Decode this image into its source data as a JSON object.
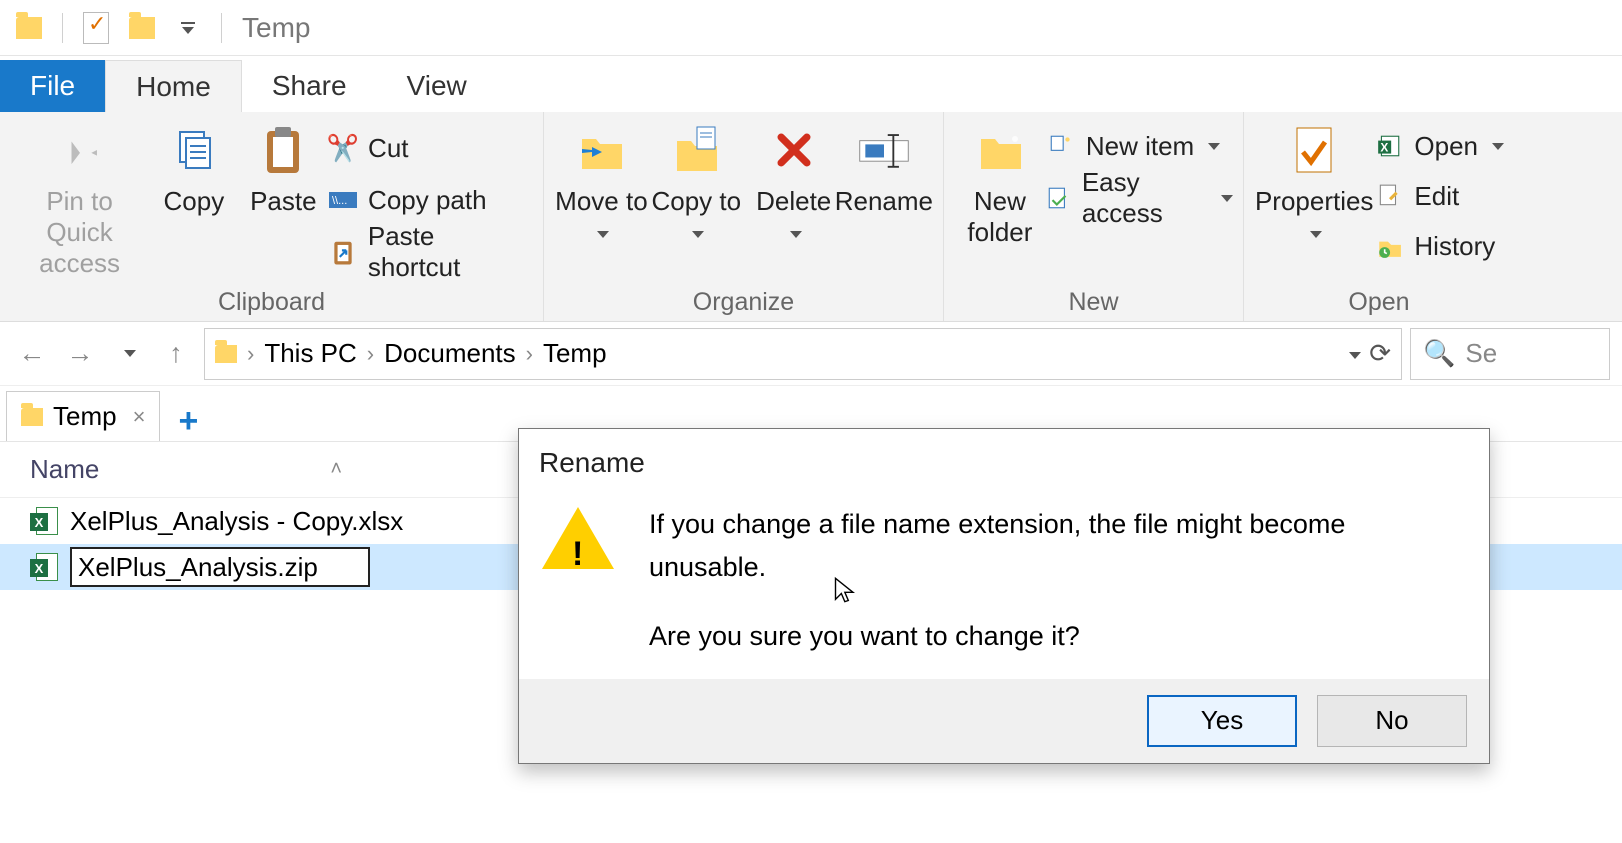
{
  "title": "Temp",
  "tabs": {
    "file": "File",
    "home": "Home",
    "share": "Share",
    "view": "View"
  },
  "ribbon": {
    "clipboard_label": "Clipboard",
    "organize_label": "Organize",
    "new_label": "New",
    "open_label": "Open",
    "pin": "Pin to Quick access",
    "copy": "Copy",
    "paste": "Paste",
    "cut": "Cut",
    "copy_path": "Copy path",
    "paste_shortcut": "Paste shortcut",
    "move_to": "Move to",
    "copy_to": "Copy to",
    "delete": "Delete",
    "rename": "Rename",
    "new_folder": "New folder",
    "new_item": "New item",
    "easy_access": "Easy access",
    "properties": "Properties",
    "open": "Open",
    "edit": "Edit",
    "history": "History"
  },
  "breadcrumb": {
    "pc": "This PC",
    "docs": "Documents",
    "temp": "Temp"
  },
  "search_placeholder": "Se",
  "folder_tab": "Temp",
  "column": {
    "name": "Name"
  },
  "files": {
    "row0": "XelPlus_Analysis - Copy.xlsx",
    "row1_editing": "XelPlus_Analysis.zip"
  },
  "dialog": {
    "title": "Rename",
    "line1": "If you change a file name extension, the file might become unusable.",
    "line2": "Are you sure you want to change it?",
    "yes": "Yes",
    "no": "No"
  }
}
